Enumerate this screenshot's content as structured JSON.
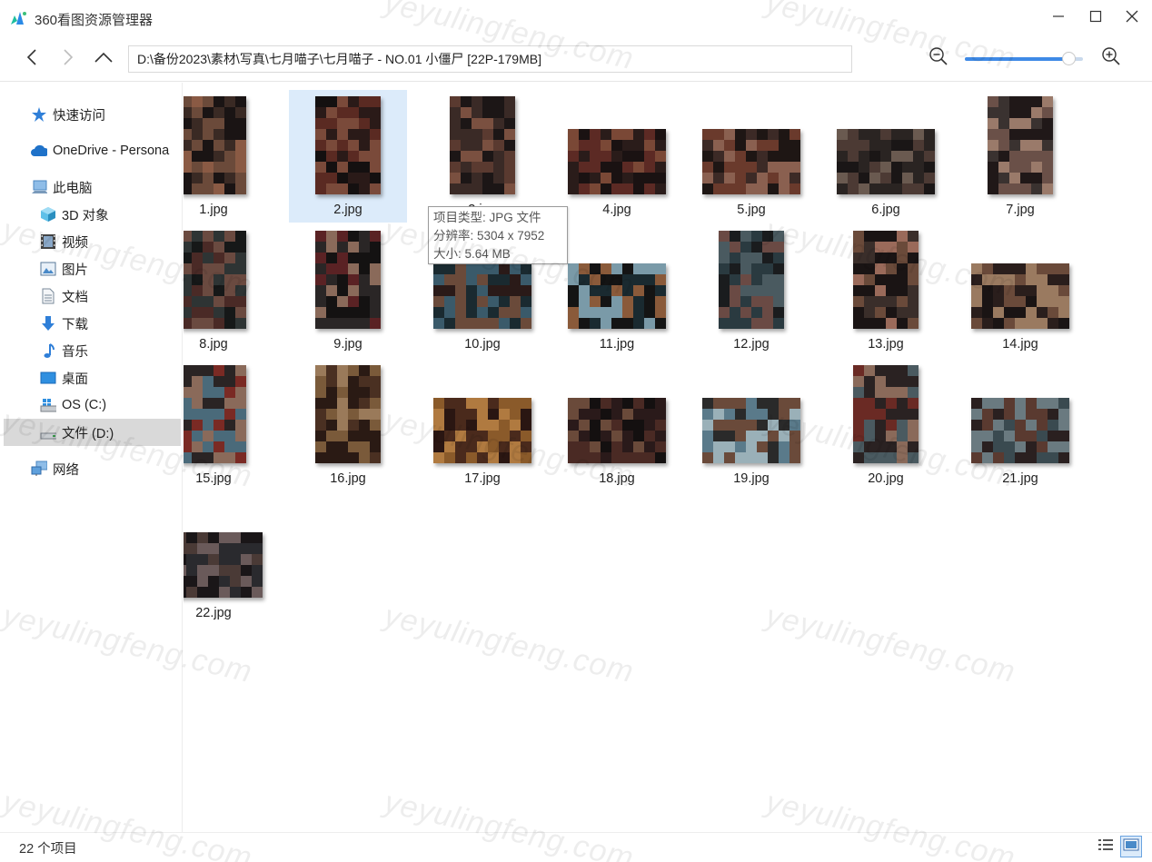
{
  "window": {
    "title": "360看图资源管理器",
    "minimize_icon": "minimize-icon",
    "maximize_icon": "maximize-icon",
    "close_icon": "close-icon"
  },
  "nav": {
    "back_icon": "chevron-left-icon",
    "forward_icon": "chevron-right-icon",
    "up_icon": "chevron-up-icon",
    "path": "D:\\备份2023\\素材\\写真\\七月喵子\\七月喵子  - NO.01 小僵尸 [22P-179MB]",
    "zoom_out_icon": "zoom-out-icon",
    "zoom_in_icon": "zoom-in-icon",
    "zoom_level": 0.88
  },
  "sidebar": {
    "items": [
      {
        "label": "快速访问",
        "icon": "pin-star-icon"
      },
      {
        "label": "OneDrive - Persona",
        "icon": "cloud-icon"
      },
      {
        "label": "此电脑",
        "icon": "computer-icon"
      },
      {
        "label": "3D 对象",
        "icon": "cube-3d-icon"
      },
      {
        "label": "视频",
        "icon": "film-icon"
      },
      {
        "label": "图片",
        "icon": "picture-icon"
      },
      {
        "label": "文档",
        "icon": "document-icon"
      },
      {
        "label": "下载",
        "icon": "download-arrow-icon"
      },
      {
        "label": "音乐",
        "icon": "music-note-icon"
      },
      {
        "label": "桌面",
        "icon": "desktop-icon"
      },
      {
        "label": "OS (C:)",
        "icon": "windows-drive-icon"
      },
      {
        "label": "文件 (D:)",
        "icon": "drive-icon"
      },
      {
        "label": "网络",
        "icon": "network-icon"
      }
    ],
    "selected_index": 11
  },
  "files": [
    {
      "name": "1.jpg",
      "orientation": "portrait",
      "palette": [
        "#3a2a24",
        "#6b4a3a",
        "#1a1414",
        "#8a5a44"
      ]
    },
    {
      "name": "2.jpg",
      "orientation": "portrait",
      "palette": [
        "#2a1a18",
        "#5a2a22",
        "#7a4a3a",
        "#141010"
      ]
    },
    {
      "name": "3.jpg",
      "orientation": "portrait",
      "palette": [
        "#3a2a26",
        "#5a3a30",
        "#1c1616",
        "#7a5040"
      ]
    },
    {
      "name": "4.jpg",
      "orientation": "landscape",
      "palette": [
        "#2a1c1a",
        "#5c2a24",
        "#1a1212",
        "#7a4836"
      ]
    },
    {
      "name": "5.jpg",
      "orientation": "landscape",
      "palette": [
        "#3c2a26",
        "#6a3a2c",
        "#1e1614",
        "#8a6050"
      ]
    },
    {
      "name": "6.jpg",
      "orientation": "landscape",
      "palette": [
        "#2a2422",
        "#4c3a34",
        "#1a1616",
        "#6a5a50"
      ]
    },
    {
      "name": "7.jpg",
      "orientation": "portrait",
      "palette": [
        "#3a3230",
        "#6a5048",
        "#201818",
        "#9a7a6a"
      ]
    },
    {
      "name": "8.jpg",
      "orientation": "portrait",
      "palette": [
        "#2e3434",
        "#4a2a26",
        "#161818",
        "#6a4a40"
      ]
    },
    {
      "name": "9.jpg",
      "orientation": "portrait",
      "palette": [
        "#2a2626",
        "#5a2224",
        "#141212",
        "#8a6a5a"
      ]
    },
    {
      "name": "10.jpg",
      "orientation": "landscape",
      "palette": [
        "#3a5a6a",
        "#2a1a18",
        "#6a4a3a",
        "#1a2a30"
      ]
    },
    {
      "name": "11.jpg",
      "orientation": "landscape",
      "palette": [
        "#1a2a30",
        "#7a9aa8",
        "#8a5a3a",
        "#141414"
      ]
    },
    {
      "name": "12.jpg",
      "orientation": "portrait",
      "palette": [
        "#2a3a40",
        "#4a5a60",
        "#1a1c1e",
        "#6a4a44"
      ]
    },
    {
      "name": "13.jpg",
      "orientation": "portrait",
      "palette": [
        "#3a2e2a",
        "#6a4a3a",
        "#1a1414",
        "#9a6a5a"
      ]
    },
    {
      "name": "14.jpg",
      "orientation": "landscape",
      "palette": [
        "#2a1e1c",
        "#6a4a3a",
        "#1a1414",
        "#9a7a60"
      ]
    },
    {
      "name": "15.jpg",
      "orientation": "portrait",
      "palette": [
        "#4a6a7a",
        "#2a2424",
        "#8a6a5a",
        "#7a2a24"
      ]
    },
    {
      "name": "16.jpg",
      "orientation": "portrait",
      "palette": [
        "#4a3022",
        "#7a5a3a",
        "#2a1a14",
        "#9a7a5a"
      ]
    },
    {
      "name": "17.jpg",
      "orientation": "landscape",
      "palette": [
        "#4a2a1c",
        "#8a5a2a",
        "#2a1612",
        "#b07a40"
      ]
    },
    {
      "name": "18.jpg",
      "orientation": "landscape",
      "palette": [
        "#2a1a1a",
        "#4a2a24",
        "#141010",
        "#6a4a3a"
      ]
    },
    {
      "name": "19.jpg",
      "orientation": "landscape",
      "palette": [
        "#5a7a8a",
        "#2a2a2a",
        "#9ab0b8",
        "#6a4a3a"
      ]
    },
    {
      "name": "20.jpg",
      "orientation": "portrait",
      "palette": [
        "#4a5a60",
        "#2a2222",
        "#8a6a5a",
        "#6a2a24"
      ]
    },
    {
      "name": "21.jpg",
      "orientation": "landscape",
      "palette": [
        "#3a4a50",
        "#2a2020",
        "#6a7a80",
        "#5a3a30"
      ]
    },
    {
      "name": "22.jpg",
      "orientation": "landscape",
      "palette": [
        "#2a2a2e",
        "#4a3a36",
        "#6a5a5a",
        "#1a1618"
      ]
    }
  ],
  "selected_file_index": 1,
  "tooltip": {
    "type_line": "项目类型: JPG 文件",
    "resolution_line": "分辨率: 5304 x 7952",
    "size_line": "大小: 5.64 MB"
  },
  "status": {
    "count_text": "22 个项目",
    "details_view_icon": "details-view-icon",
    "thumbnail_view_icon": "thumbnail-view-icon"
  },
  "watermark_text": "yeyulingfeng.com"
}
